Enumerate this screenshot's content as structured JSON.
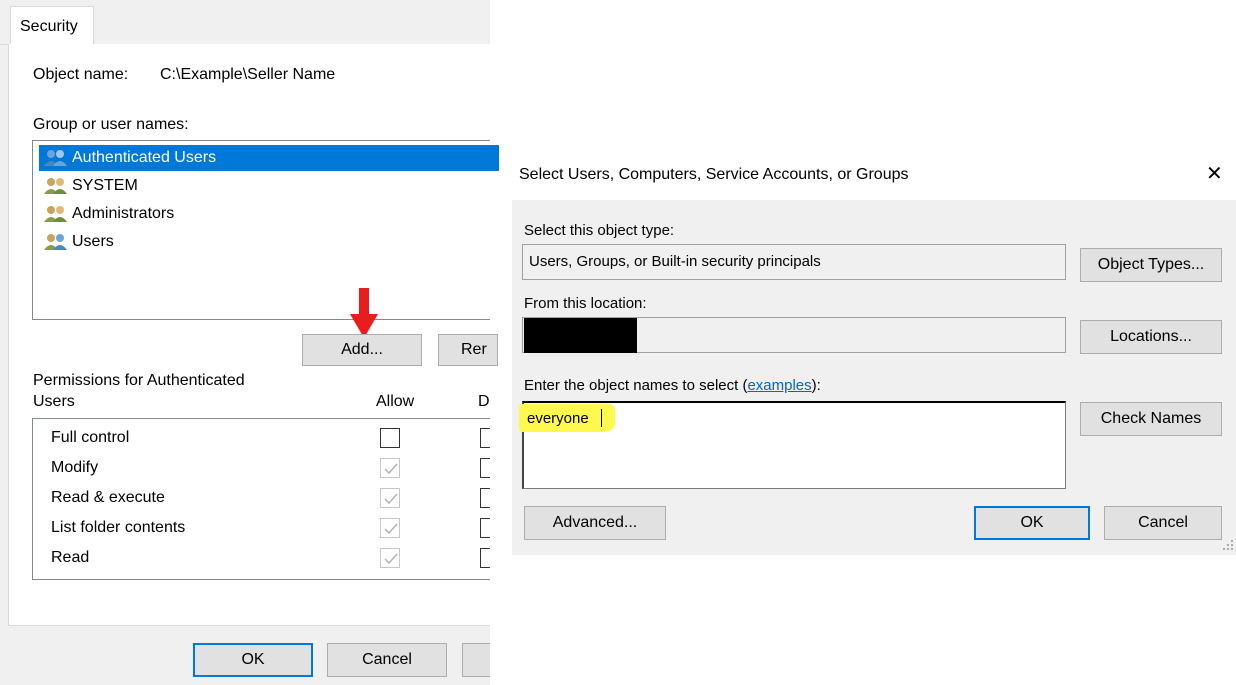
{
  "security_dialog": {
    "tab_label": "Security",
    "object_name_label": "Object name:",
    "object_name_value": "C:\\Example\\Seller Name",
    "group_label": "Group or user names:",
    "users": [
      {
        "name": "Authenticated Users",
        "selected": true
      },
      {
        "name": "SYSTEM",
        "selected": false
      },
      {
        "name": "Administrators",
        "selected": false
      },
      {
        "name": "Users",
        "selected": false
      }
    ],
    "add_button": "Add...",
    "remove_button_partial": "Rer",
    "permissions_label_line1": "Permissions for Authenticated",
    "permissions_label_line2": "Users",
    "allow_header": "Allow",
    "deny_header_partial": "D",
    "permissions": [
      {
        "name": "Full control",
        "allow": false,
        "allow_enabled": true
      },
      {
        "name": "Modify",
        "allow": true,
        "allow_enabled": false
      },
      {
        "name": "Read & execute",
        "allow": true,
        "allow_enabled": false
      },
      {
        "name": "List folder contents",
        "allow": true,
        "allow_enabled": false
      },
      {
        "name": "Read",
        "allow": true,
        "allow_enabled": false
      }
    ],
    "ok_button": "OK",
    "cancel_button": "Cancel"
  },
  "select_dialog": {
    "title": "Select Users, Computers, Service Accounts, or Groups",
    "close_glyph": "✕",
    "object_type_label": "Select this object type:",
    "object_type_value": "Users, Groups, or Built-in security principals",
    "object_types_button": "Object Types...",
    "location_label": "From this location:",
    "locations_button": "Locations...",
    "enter_names_label_prefix": "Enter the object names to select (",
    "examples_link": "examples",
    "enter_names_label_suffix": "):",
    "names_value": "everyone",
    "check_names_button": "Check Names",
    "advanced_button": "Advanced...",
    "ok_button": "OK",
    "cancel_button": "Cancel"
  },
  "colors": {
    "selection": "#0078d7",
    "highlight": "#fff94f",
    "arrow": "#e81e1e",
    "link": "#0066cc"
  }
}
